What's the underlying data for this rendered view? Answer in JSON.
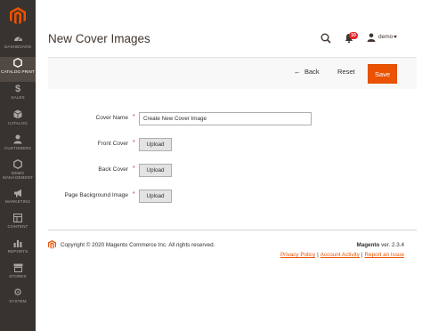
{
  "sidebar": {
    "items": [
      {
        "label": "DASHBOARD",
        "icon": "dashboard-icon"
      },
      {
        "label": "CATALOG PRINT",
        "icon": "hexagon-icon",
        "active": true
      },
      {
        "label": "SALES",
        "icon": "dollar-icon"
      },
      {
        "label": "CATALOG",
        "icon": "box-icon"
      },
      {
        "label": "CUSTOMERS",
        "icon": "person-icon"
      },
      {
        "label": "DEMO MANAGEMENT",
        "icon": "hexagon-icon"
      },
      {
        "label": "MARKETING",
        "icon": "megaphone-icon"
      },
      {
        "label": "CONTENT",
        "icon": "layout-icon"
      },
      {
        "label": "REPORTS",
        "icon": "bar-chart-icon"
      },
      {
        "label": "STORES",
        "icon": "store-icon"
      },
      {
        "label": "SYSTEM",
        "icon": "gear-icon"
      }
    ]
  },
  "header": {
    "title": "New Cover Images",
    "notification_count": "10",
    "user": "demo"
  },
  "actions": {
    "back": "Back",
    "reset": "Reset",
    "save": "Save"
  },
  "form": {
    "cover_name_label": "Cover Name",
    "cover_name_value": "Create New Cover Image",
    "front_cover_label": "Front Cover",
    "back_cover_label": "Back Cover",
    "page_bg_label": "Page Background Image",
    "upload_label": "Upload"
  },
  "footer": {
    "copyright": "Copyright © 2020 Magento Commerce Inc. All rights reserved.",
    "brand": "Magento",
    "version": "ver. 2.3.4",
    "links": [
      "Privacy Policy",
      "Account Activity",
      "Report an Issue"
    ],
    "separator": "|"
  },
  "colors": {
    "accent": "#eb5202",
    "sidebar_bg": "#373330",
    "sidebar_active": "#514943"
  }
}
